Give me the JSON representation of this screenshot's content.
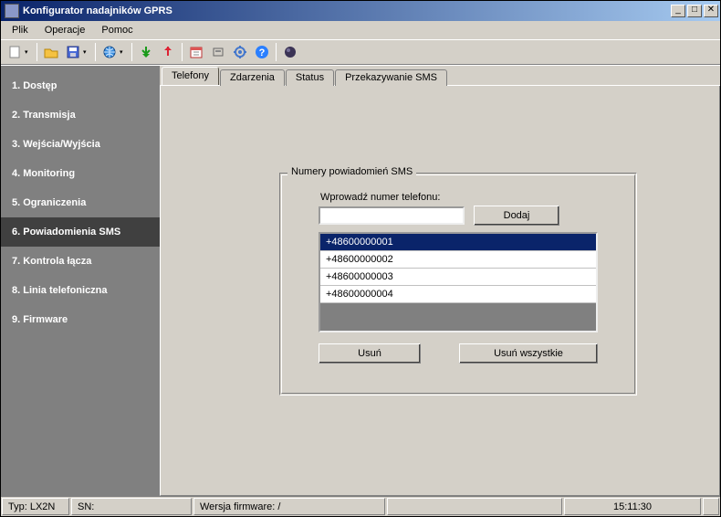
{
  "window": {
    "title": "Konfigurator nadajników GPRS"
  },
  "menu": {
    "file": "Plik",
    "operations": "Operacje",
    "help": "Pomoc"
  },
  "sidebar": {
    "items": [
      {
        "label": "1. Dostęp"
      },
      {
        "label": "2. Transmisja"
      },
      {
        "label": "3. Wejścia/Wyjścia"
      },
      {
        "label": "4. Monitoring"
      },
      {
        "label": "5. Ograniczenia"
      },
      {
        "label": "6. Powiadomienia SMS"
      },
      {
        "label": "7. Kontrola łącza"
      },
      {
        "label": "8. Linia telefoniczna"
      },
      {
        "label": "9. Firmware"
      }
    ],
    "active_index": 5
  },
  "tabs": {
    "items": [
      {
        "label": "Telefony"
      },
      {
        "label": "Zdarzenia"
      },
      {
        "label": "Status"
      },
      {
        "label": "Przekazywanie SMS"
      }
    ],
    "active_index": 0
  },
  "panel": {
    "group_title": "Numery powiadomień SMS",
    "input_label": "Wprowadź numer telefonu:",
    "input_value": "",
    "add_btn": "Dodaj",
    "delete_btn": "Usuń",
    "delete_all_btn": "Usuń wszystkie",
    "numbers": [
      "+48600000001",
      "+48600000002",
      "+48600000003",
      "+48600000004"
    ],
    "selected_index": 0
  },
  "status": {
    "type_label": "Typ: LX2N",
    "sn_label": "SN:",
    "fw_label": "Wersja firmware: /",
    "time": "15:11:30"
  },
  "colors": {
    "titlebar_from": "#0a246a",
    "titlebar_to": "#a6caf0",
    "sidebar_bg": "#808080",
    "sidebar_active": "#404040",
    "face": "#d4d0c8",
    "selection": "#0a246a"
  }
}
